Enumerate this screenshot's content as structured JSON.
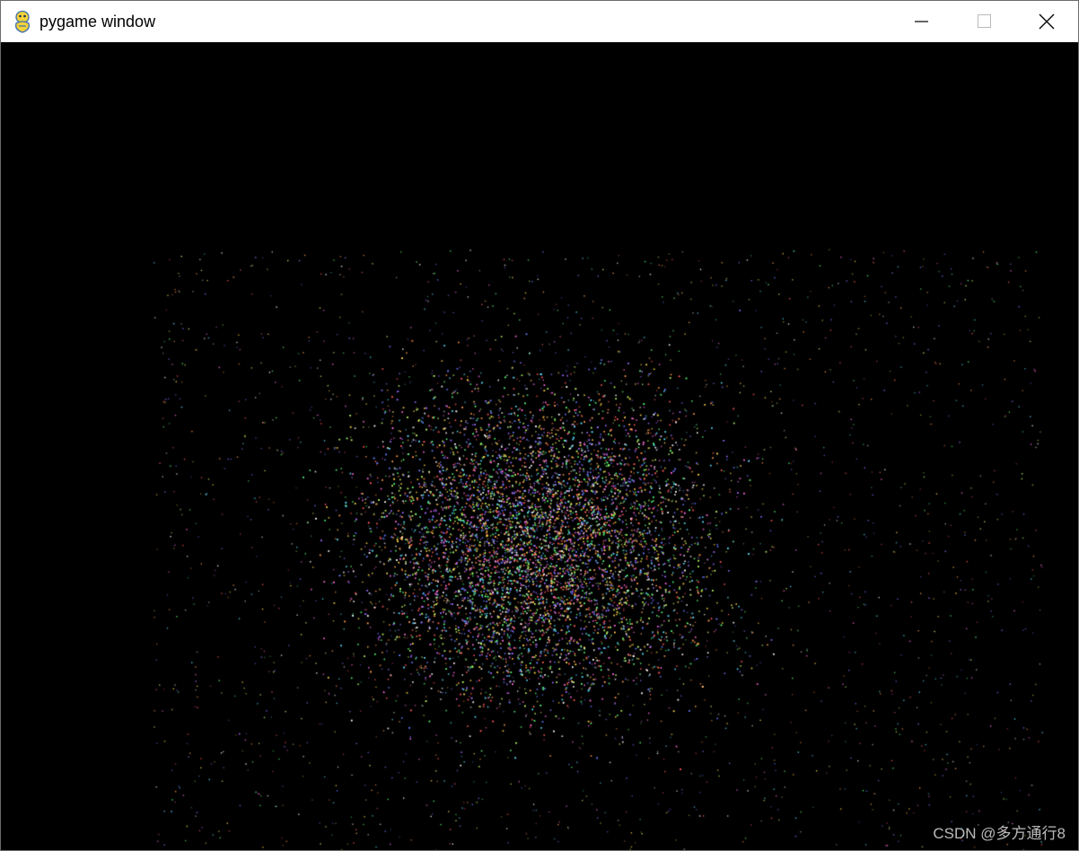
{
  "window": {
    "title": "pygame window",
    "app_icon": "pygame-snake-icon",
    "controls": {
      "minimize_icon": "minimize-icon",
      "maximize_icon": "maximize-icon",
      "close_icon": "close-icon"
    }
  },
  "canvas": {
    "background": "#000000",
    "particle_palette": [
      "#ff5a5a",
      "#5aff7a",
      "#6a7bff",
      "#ffd84a",
      "#ff6adf",
      "#5adfff",
      "#ffffff",
      "#c0ff6a",
      "#ff9a4a",
      "#9a6aff"
    ]
  },
  "watermark": {
    "text": "CSDN @多方通行8"
  }
}
